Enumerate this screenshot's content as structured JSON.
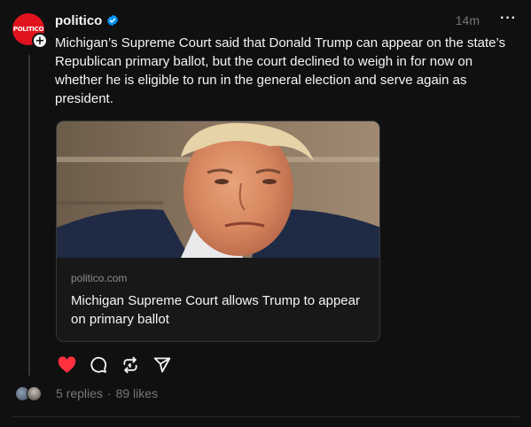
{
  "author": {
    "avatar_text": "POLITICO",
    "username": "politico",
    "verified": true,
    "time": "14m",
    "more_icon": "more-horizontal-icon"
  },
  "post": {
    "text": "Michigan’s Supreme Court said that Donald Trump can appear on the state’s Republican primary ballot, but the court declined to weigh in for now on whether he is eligible to run in the general election and serve again as president."
  },
  "link_card": {
    "domain": "politico.com",
    "title": "Michigan Supreme Court allows Trump to appear on primary ballot"
  },
  "actions": {
    "like_icon": "heart-filled-icon",
    "reply_icon": "comment-icon",
    "repost_icon": "repost-icon",
    "share_icon": "send-icon",
    "like_color": "#ff3040"
  },
  "footer": {
    "replies": "5 replies",
    "separator": "·",
    "likes": "89 likes"
  },
  "colors": {
    "background": "#101010",
    "text_primary": "#f3f5f7",
    "text_secondary": "#777777",
    "verified_blue": "#0095f6",
    "brand_red": "#e1131f"
  }
}
